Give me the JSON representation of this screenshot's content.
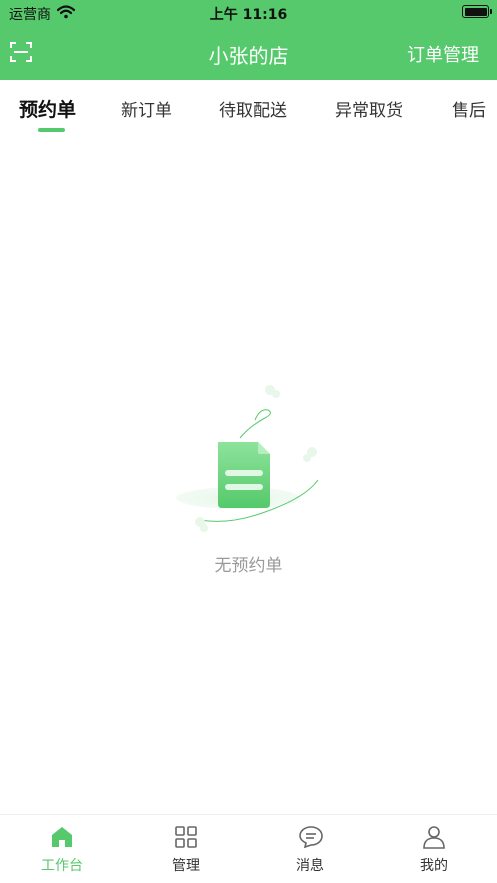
{
  "status_bar": {
    "carrier": "运营商",
    "time": "上午 11:16"
  },
  "navbar": {
    "left_icon": "scan-icon",
    "title": "小张的店",
    "right_label": "订单管理"
  },
  "tabs": [
    {
      "label": "预约单",
      "active": true
    },
    {
      "label": "新订单",
      "active": false
    },
    {
      "label": "待取配送",
      "active": false
    },
    {
      "label": "异常取货",
      "active": false
    },
    {
      "label": "售后",
      "active": false
    }
  ],
  "empty_state": {
    "icon": "empty-document-icon",
    "text": "无预约单"
  },
  "bottom_tabs": [
    {
      "label": "工作台",
      "icon": "home-icon",
      "active": true
    },
    {
      "label": "管理",
      "icon": "grid-icon",
      "active": false
    },
    {
      "label": "消息",
      "icon": "message-icon",
      "active": false
    },
    {
      "label": "我的",
      "icon": "user-icon",
      "active": false
    }
  ],
  "colors": {
    "brand_green": "#55c96b",
    "text_dark": "#111111",
    "text_muted": "#9a9a9a"
  }
}
